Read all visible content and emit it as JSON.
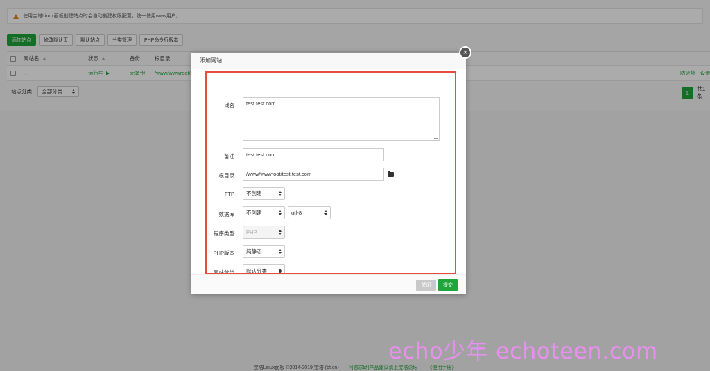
{
  "notice": {
    "text": "使用宝塔Linux面板创建站点时会自动创建权限配置，统一使用www用户。"
  },
  "toolbar": {
    "add_site": "添加站点",
    "modify_default_page": "修改默认页",
    "default_site": "默认站点",
    "category_manage": "分类管理",
    "php_cli_version": "PHP命令行版本"
  },
  "table": {
    "headers": {
      "site_name": "网站名",
      "status": "状态",
      "backup": "备份",
      "root": "根目录"
    },
    "rows": [
      {
        "site_name": ". .",
        "status": "运行中",
        "backup": "无备份",
        "root": "/www/wwwroot/",
        "actions": "防火墙 | 设置"
      }
    ]
  },
  "filter": {
    "label": "站点分类:",
    "value": "全部分类"
  },
  "pager": {
    "current": "1",
    "total": "共1条"
  },
  "footer": {
    "copyright": "宝塔Linux面板 ©2014-2019 宝塔 (bt.cn)",
    "feedback": "问题求助|产品建议请上宝塔论坛",
    "manual": "《使用手册》"
  },
  "dialog": {
    "title": "添加网站",
    "close_icon": "×",
    "domain_label": "域名",
    "domain_value": "test.test.com",
    "remark_label": "备注",
    "remark_value": "test.test.com",
    "root_label": "根目录",
    "root_value": "/www/wwwroot/test.test.com",
    "ftp_label": "FTP",
    "ftp_value": "不创建",
    "db_label": "数据库",
    "db_value": "不创建",
    "db_charset": "utf-8",
    "program_label": "程序类型",
    "program_value": "PHP",
    "php_label": "PHP版本",
    "php_value": "纯静态",
    "category_label": "网站分类",
    "category_value": "默认分类",
    "btn_close": "关闭",
    "btn_submit": "提交"
  },
  "watermark": "echo少年 echoteen.com",
  "colors": {
    "accent": "#20a53a",
    "highlight": "#e74c3c",
    "watermark": "#e98ff0"
  }
}
